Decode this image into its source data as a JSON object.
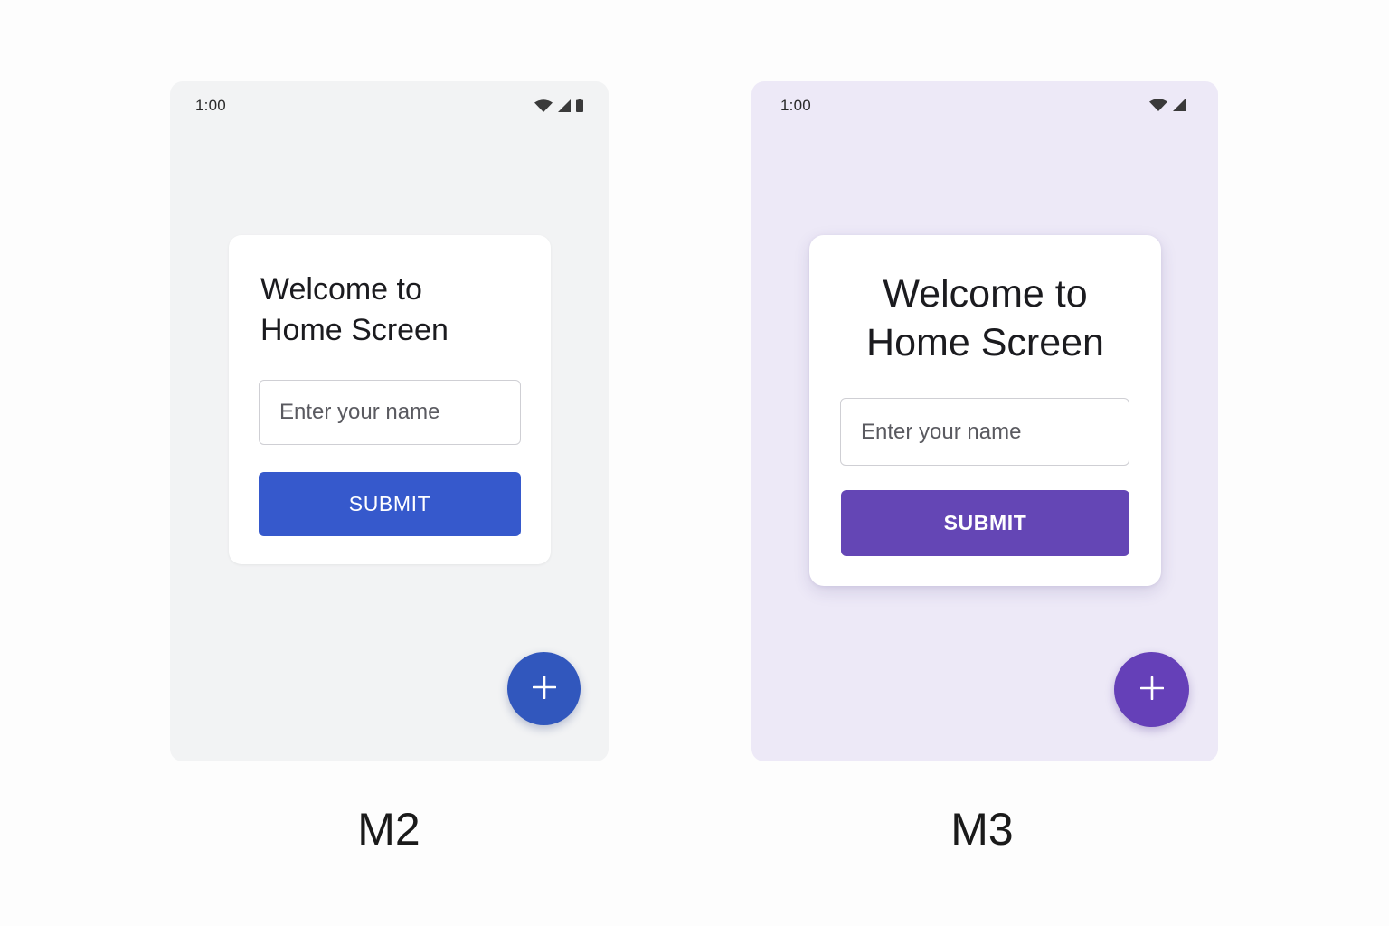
{
  "colors": {
    "m2_background": "#f2f3f4",
    "m3_background": "#ede9f7",
    "m2_primary": "#3659cc",
    "m3_primary": "#6446b5",
    "card": "#ffffff"
  },
  "m2": {
    "status": {
      "time": "1:00",
      "icons": [
        "wifi-icon",
        "cellular-signal-icon",
        "battery-icon"
      ]
    },
    "card": {
      "title_line1": "Welcome to",
      "title_line2": "Home Screen",
      "input_placeholder": "Enter your name",
      "submit_label": "SUBMIT"
    },
    "fab": {
      "icon": "plus-icon"
    },
    "caption": "M2"
  },
  "m3": {
    "status": {
      "time": "1:00",
      "icons": [
        "wifi-icon",
        "cellular-signal-icon"
      ]
    },
    "card": {
      "title_line1": "Welcome to",
      "title_line2": "Home Screen",
      "input_placeholder": "Enter your name",
      "submit_label": "SUBMIT"
    },
    "fab": {
      "icon": "plus-icon"
    },
    "caption": "M3"
  }
}
